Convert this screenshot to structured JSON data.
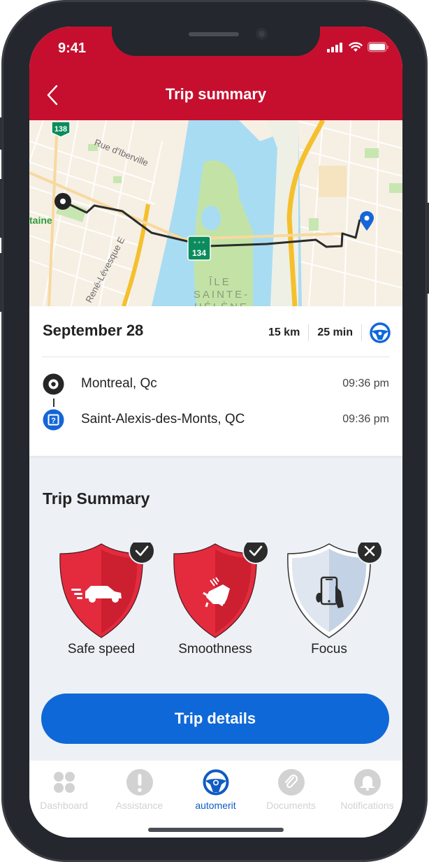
{
  "status_bar": {
    "time": "9:41"
  },
  "header": {
    "title": "Trip summary",
    "back_icon": "chevron-left-icon"
  },
  "map": {
    "labels": {
      "route_shield_top": "138",
      "route_shield_bridge": "134",
      "street_1": "Rue d'Iberville",
      "street_2": "René-Lévesque E",
      "place_left": "taine",
      "island_line1": "ÎLE",
      "island_line2": "SAINTE-",
      "island_line3": "HÉLÈNE"
    }
  },
  "trip": {
    "date": "September 28",
    "distance": "15 km",
    "duration": "25 min",
    "mode_icon": "steering-wheel-icon",
    "stops": [
      {
        "type": "origin",
        "icon": "origin-target-icon",
        "name": "Montreal, Qc",
        "time": "09:36 pm"
      },
      {
        "type": "destination",
        "icon": "unknown-destination-icon",
        "name": "Saint-Alexis-des-Monts, QC",
        "time": "09:36 pm"
      }
    ]
  },
  "summary": {
    "title": "Trip Summary",
    "badges": [
      {
        "label": "Safe speed",
        "status": "passed",
        "icon": "speeding-car-icon",
        "color": "#e0243a"
      },
      {
        "label": "Smoothness",
        "status": "passed",
        "icon": "brake-pedal-icon",
        "color": "#e0243a"
      },
      {
        "label": "Focus",
        "status": "failed",
        "icon": "phone-in-hand-icon",
        "color": "#c9d6e6"
      }
    ]
  },
  "cta": {
    "label": "Trip details"
  },
  "tabbar": {
    "items": [
      {
        "label": "Dashboard",
        "icon": "grid-dots-icon",
        "active": false
      },
      {
        "label": "Assistance",
        "icon": "exclamation-icon",
        "active": false
      },
      {
        "label": "automerit",
        "icon": "steering-wheel-icon",
        "active": true
      },
      {
        "label": "Documents",
        "icon": "paperclip-icon",
        "active": false
      },
      {
        "label": "Notifications",
        "icon": "bell-icon",
        "active": false
      }
    ]
  },
  "colors": {
    "brand_red": "#c60f2e",
    "accent_blue": "#0f68d8",
    "inactive_gray": "#d2d2d2"
  }
}
